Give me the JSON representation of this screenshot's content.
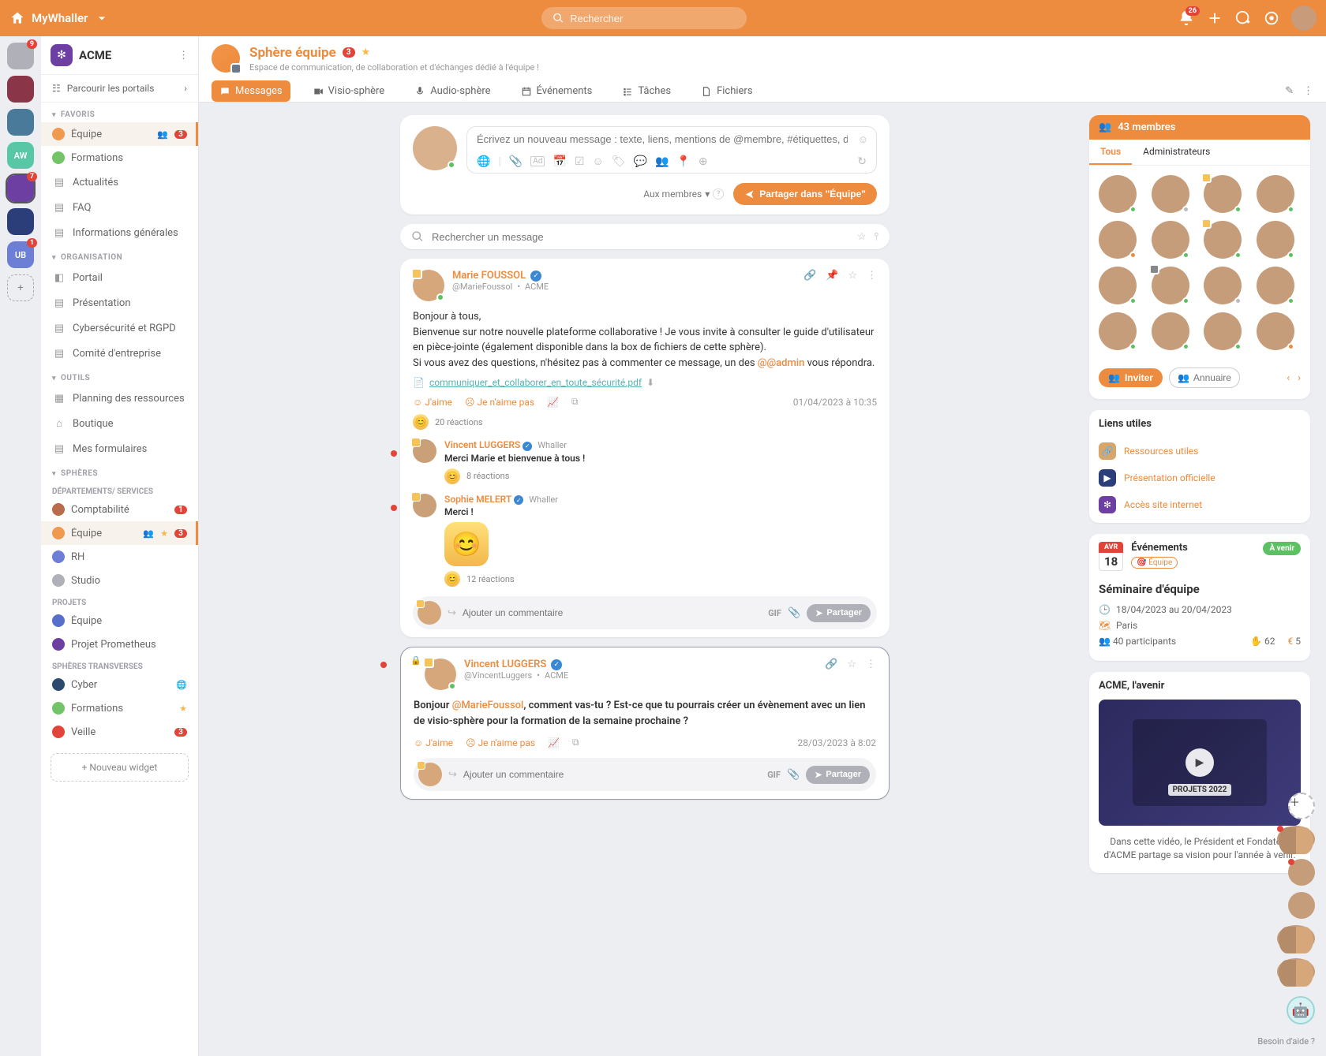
{
  "topbar": {
    "brand": "MyWhaller",
    "search_placeholder": "Rechercher",
    "notif_count": "26"
  },
  "rail": {
    "items": [
      {
        "label": "",
        "badge": "9",
        "active": false
      },
      {
        "label": "",
        "badge": "",
        "active": false
      },
      {
        "label": "",
        "badge": "",
        "active": false
      },
      {
        "label": "AW",
        "badge": "",
        "active": false,
        "bg": "#57c7a5"
      },
      {
        "label": "",
        "badge": "7",
        "active": true,
        "bg": "#6e3fa3"
      },
      {
        "label": "",
        "badge": "",
        "active": false,
        "bg": "#2c3e7a"
      },
      {
        "label": "UB",
        "badge": "1",
        "active": false,
        "bg": "#6c7ed6"
      }
    ]
  },
  "workspace": {
    "name": "ACME",
    "browse_portals": "Parcourir les portails"
  },
  "sidebar": {
    "favoris_label": "FAVORIS",
    "organisation_label": "ORGANISATION",
    "outils_label": "OUTILS",
    "spheres_label": "SPHÈRES",
    "favoris": [
      {
        "label": "Équipe",
        "badge": "3",
        "dot": "#f09a50",
        "active": true,
        "people": true
      },
      {
        "label": "Formations",
        "dot": "#73c468"
      },
      {
        "label": "Actualités",
        "icon": true
      },
      {
        "label": "FAQ",
        "icon": true
      },
      {
        "label": "Informations générales",
        "icon": true
      }
    ],
    "organisation": [
      {
        "label": "Portail"
      },
      {
        "label": "Présentation"
      },
      {
        "label": "Cybersécurité et RGPD"
      },
      {
        "label": "Comité d'entreprise"
      }
    ],
    "outils": [
      {
        "label": "Planning des ressources"
      },
      {
        "label": "Boutique"
      },
      {
        "label": "Mes formulaires"
      }
    ],
    "spheres_group1_label": "DÉPARTEMENTS/ SERVICES",
    "spheres_group1": [
      {
        "label": "Comptabilité",
        "badge": "1",
        "dot": "#b86c4c"
      },
      {
        "label": "Équipe",
        "badge": "3",
        "dot": "#f09a50",
        "active": true,
        "people": true,
        "star": true
      },
      {
        "label": "RH",
        "dot": "#6c7ed6"
      },
      {
        "label": "Studio",
        "dot": "#b0b0b8"
      }
    ],
    "spheres_group2_label": "PROJETS",
    "spheres_group2": [
      {
        "label": "Équipe",
        "dot": "#5670c9"
      },
      {
        "label": "Projet Prometheus",
        "dot": "#6e3fa3"
      }
    ],
    "spheres_group3_label": "SPHÈRES TRANSVERSES",
    "spheres_group3": [
      {
        "label": "Cyber",
        "dot": "#2c4a6e",
        "globe": true
      },
      {
        "label": "Formations",
        "dot": "#73c468",
        "star": true
      },
      {
        "label": "Veille",
        "badge": "3",
        "dot": "#e2443a"
      }
    ],
    "new_widget": "Nouveau widget"
  },
  "sphere": {
    "title": "Sphère équipe",
    "count": "3",
    "subtitle": "Espace de communication, de collaboration et d'échanges dédié à l'équipe !",
    "tabs": {
      "messages": "Messages",
      "visio": "Visio-sphère",
      "audio": "Audio-sphère",
      "events": "Événements",
      "tasks": "Tâches",
      "files": "Fichiers"
    }
  },
  "composer": {
    "placeholder": "Écrivez un nouveau message : texte, liens, mentions de @membre, #étiquettes, docs, événements, etc.",
    "audience": "Aux membres",
    "share_label": "Partager dans \"Équipe\""
  },
  "msg_search": {
    "placeholder": "Rechercher un message"
  },
  "post1": {
    "author": "Marie FOUSSOL",
    "handle": "@MarieFoussol",
    "org": "ACME",
    "line1": "Bonjour à tous,",
    "line2": "Bienvenue sur notre nouvelle plateforme collaborative ! Je vous invite à consulter le guide d'utilisateur en pièce-jointe (également disponible dans la box de fichiers de cette sphère).",
    "line3a": "Si vous avez des questions, n'hésitez pas à commenter ce message, un des ",
    "line3_mention": "@@admin",
    "line3b": " vous répondra.",
    "attachment": "communiquer_et_collaborer_en_toute_sécurité.pdf",
    "like": "J'aime",
    "dislike": "Je n'aime pas",
    "timestamp": "01/04/2023 à 10:35",
    "reactions": "20 réactions",
    "reply1_author": "Vincent LUGGERS",
    "reply1_org": "Whaller",
    "reply1_text": "Merci Marie et bienvenue à tous !",
    "reply1_reactions": "8 réactions",
    "reply2_author": "Sophie MELERT",
    "reply2_org": "Whaller",
    "reply2_text": "Merci !",
    "reply2_reactions": "12 réactions",
    "comment_placeholder": "Ajouter un commentaire",
    "gif": "GIF",
    "share": "Partager"
  },
  "post2": {
    "author": "Vincent LUGGERS",
    "handle": "@VincentLuggers",
    "org": "ACME",
    "text_a": "Bonjour ",
    "text_mention": "@MarieFoussol",
    "text_b": ", comment vas-tu ? Est-ce que tu pourrais créer un évènement avec un lien de visio-sphère pour la formation de la semaine prochaine ?",
    "like": "J'aime",
    "dislike": "Je n'aime pas",
    "timestamp": "28/03/2023 à 8:02",
    "comment_placeholder": "Ajouter un commentaire",
    "gif": "GIF",
    "share": "Partager"
  },
  "members": {
    "header": "43 membres",
    "tab_all": "Tous",
    "tab_admins": "Administrateurs",
    "invite": "Inviter",
    "directory": "Annuaire"
  },
  "links": {
    "header": "Liens utiles",
    "l1": "Ressources utiles",
    "l2": "Présentation officielle",
    "l3": "Accès site internet"
  },
  "event": {
    "section": "Événements",
    "month": "AVR",
    "day": "18",
    "chip": "Équipe",
    "status": "À venir",
    "title": "Séminaire d'équipe",
    "dates": "18/04/2023 au 20/04/2023",
    "location": "Paris",
    "participants": "40 participants",
    "count1": "62",
    "count2": "5"
  },
  "video": {
    "header": "ACME, l'avenir",
    "caption": "PROJETS 2022",
    "description": "Dans cette vidéo, le Président et Fondateur d'ACME partage sa vision pour l'année à venir."
  },
  "help": "Besoin d'aide ?"
}
